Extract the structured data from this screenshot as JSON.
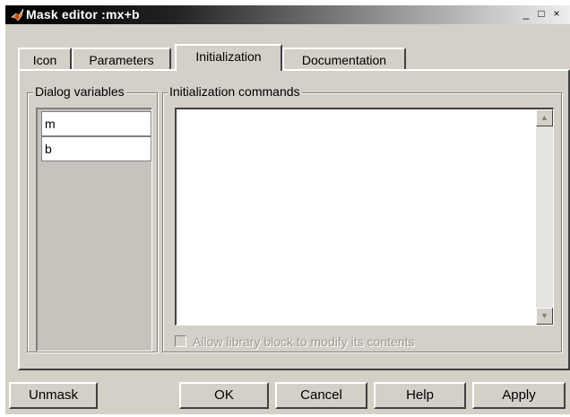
{
  "window": {
    "title": "Mask editor :mx+b",
    "minimize_label": "_",
    "maximize_label": "□",
    "close_label": "×"
  },
  "tabs": [
    {
      "label": "Icon",
      "active": false
    },
    {
      "label": "Parameters",
      "active": false
    },
    {
      "label": "Initialization",
      "active": true
    },
    {
      "label": "Documentation",
      "active": false
    }
  ],
  "dialog_variables": {
    "label": "Dialog variables",
    "items": [
      "m",
      "b"
    ]
  },
  "init_commands": {
    "label": "Initialization commands",
    "value": "",
    "scroll_up": "▲",
    "scroll_down": "▼"
  },
  "allow_modify": {
    "label": "Allow library block to modify its contents",
    "checked": false,
    "enabled": false
  },
  "buttons": {
    "unmask": "Unmask",
    "ok": "OK",
    "cancel": "Cancel",
    "help": "Help",
    "apply": "Apply"
  },
  "colors": {
    "face": "#d4d0c8",
    "shadow": "#404040",
    "highlight": "#ffffff"
  }
}
